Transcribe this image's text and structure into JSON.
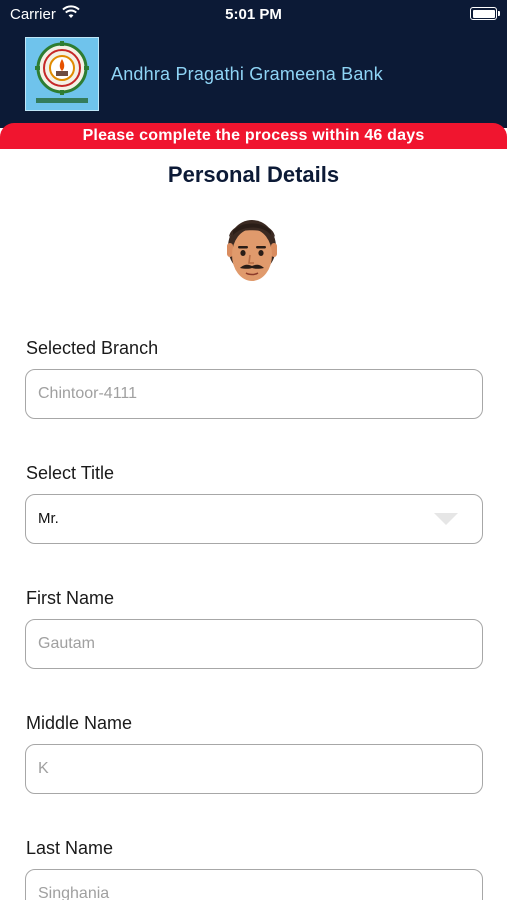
{
  "status_bar": {
    "carrier": "Carrier",
    "time": "5:01 PM"
  },
  "header": {
    "bank_name": "Andhra Pragathi Grameena Bank",
    "logo_icon": "bank-logo-icon"
  },
  "banner": {
    "text": "Please complete the process within 46 days"
  },
  "page": {
    "title": "Personal Details",
    "avatar_icon": "man-avatar-icon"
  },
  "form": {
    "branch": {
      "label": "Selected Branch",
      "value": "Chintoor-4111"
    },
    "title": {
      "label": "Select Title",
      "value": "Mr."
    },
    "first_name": {
      "label": "First Name",
      "value": "Gautam"
    },
    "middle_name": {
      "label": "Middle Name",
      "value": "K"
    },
    "last_name": {
      "label": "Last Name",
      "value": "Singhania"
    }
  },
  "colors": {
    "header_bg": "#0c1a36",
    "banner_bg": "#f0152f",
    "bank_name": "#8fd4f5",
    "field_border": "#a7a7a7"
  }
}
